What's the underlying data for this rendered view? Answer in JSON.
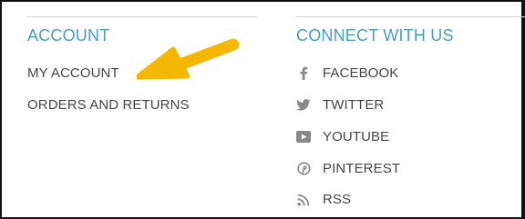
{
  "account": {
    "heading": "ACCOUNT",
    "links": [
      "MY ACCOUNT",
      "ORDERS AND RETURNS"
    ]
  },
  "connect": {
    "heading": "CONNECT WITH US",
    "items": [
      {
        "label": "FACEBOOK",
        "icon": "facebook-icon"
      },
      {
        "label": "TWITTER",
        "icon": "twitter-icon"
      },
      {
        "label": "YOUTUBE",
        "icon": "youtube-icon"
      },
      {
        "label": "PINTEREST",
        "icon": "pinterest-icon"
      },
      {
        "label": "RSS",
        "icon": "rss-icon"
      }
    ]
  },
  "colors": {
    "heading": "#4a9bc8",
    "text": "#444444",
    "icon": "#888888",
    "arrow": "#f5b800"
  }
}
